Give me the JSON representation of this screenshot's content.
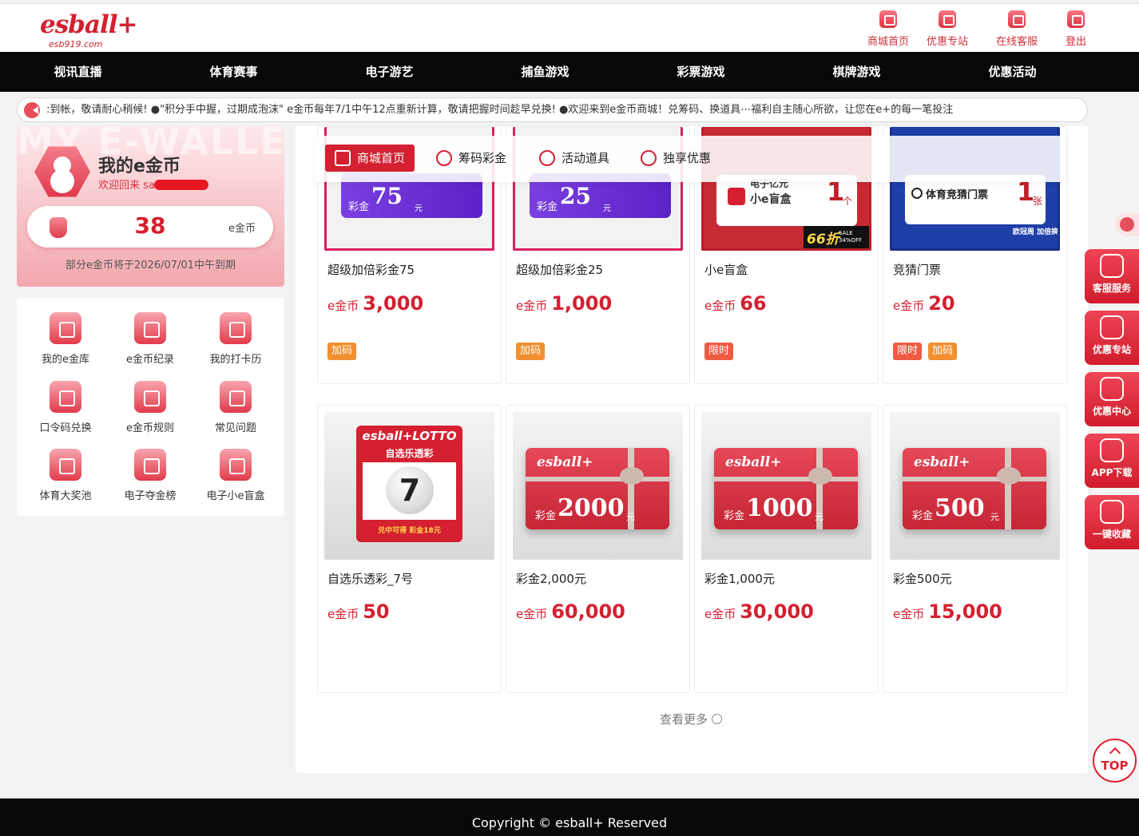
{
  "header": {
    "logo": "esball+",
    "domain": "esb919.com",
    "nav": [
      {
        "label": "商城首页",
        "icon": "home-icon"
      },
      {
        "label": "优惠专站",
        "icon": "flag-icon"
      },
      {
        "label": "在线客服",
        "icon": "chat-icon"
      },
      {
        "label": "登出",
        "icon": "logout-icon"
      }
    ]
  },
  "main_nav": [
    "视讯直播",
    "体育赛事",
    "电子游艺",
    "捕鱼游戏",
    "彩票游戏",
    "棋牌游戏",
    "优惠活动"
  ],
  "marquee": {
    "text": ":到帐，敬请耐心稍候!        ●\"积分手中握，过期成泡沫\" e金币每年7/1中午12点重新计算，敬请把握时间趁早兑换!        ●欢迎来到e金币商城！兑筹码、换道具⋯福利自主随心所欲，让您在e+的每一笔投注"
  },
  "wallet": {
    "bg_text": "MY E-WALLET",
    "title": "我的e金币",
    "welcome": "欢迎回来 sa",
    "balance": "38",
    "unit": "e金币",
    "expiry": "部分e金币将于2026/07/01中午到期"
  },
  "menu": [
    {
      "label": "我的e金库",
      "icon": "vault-icon"
    },
    {
      "label": "e金币纪录",
      "icon": "money-bag-icon"
    },
    {
      "label": "我的打卡历",
      "icon": "calendar-icon"
    },
    {
      "label": "口令码兑换",
      "icon": "lock-icon"
    },
    {
      "label": "e金币规则",
      "icon": "clipboard-icon"
    },
    {
      "label": "常见问题",
      "icon": "qa-icon"
    },
    {
      "label": "体育大奖池",
      "icon": "soccer-icon"
    },
    {
      "label": "电子夺金榜",
      "icon": "podium-icon"
    },
    {
      "label": "电子小e盲盒",
      "icon": "blind-box-icon"
    }
  ],
  "tabs": [
    {
      "label": "商城首页",
      "icon": "home-icon"
    },
    {
      "label": "筹码彩金",
      "icon": "chip-icon"
    },
    {
      "label": "活动道具",
      "icon": "diamond-icon"
    },
    {
      "label": "独享优惠",
      "icon": "gift-icon"
    }
  ],
  "products_row1": [
    {
      "name": "超级加倍彩金75",
      "unit": "e金币",
      "price": "3,000",
      "tags": [
        "加码"
      ],
      "voucher_label": "彩金",
      "voucher_value": "75",
      "voucher_unit": "元"
    },
    {
      "name": "超级加倍彩金25",
      "unit": "e金币",
      "price": "1,000",
      "tags": [
        "加码"
      ],
      "voucher_label": "彩金",
      "voucher_value": "25",
      "voucher_unit": "元"
    },
    {
      "name": "小e盲盒",
      "unit": "e金币",
      "price": "66",
      "tags": [
        "限时"
      ],
      "img_line1": "电子亿元",
      "img_line2": "小e盲盒",
      "img_count": "1",
      "img_count_unit": "个",
      "sale": "66折",
      "sale_sub": "SALE 34%OFF"
    },
    {
      "name": "竞猜门票",
      "unit": "e金币",
      "price": "20",
      "tags": [
        "限时",
        "加码"
      ],
      "img_line1": "体育竞猜门票",
      "img_count": "1",
      "img_count_unit": "张",
      "badge": "欧冠周 加倍换"
    }
  ],
  "products_row2": [
    {
      "name": "自选乐透彩_7号",
      "unit": "e金币",
      "price": "50",
      "lotto_brand": "esball+LOTTO",
      "lotto_title": "自选乐透彩",
      "lotto_ball": "7",
      "lotto_note": "兑中可得 彩金18元"
    },
    {
      "name": "彩金2,000元",
      "unit": "e金币",
      "price": "60,000",
      "gift_brand": "esball+",
      "gift_label": "彩金",
      "gift_value": "2000",
      "gift_unit": "元"
    },
    {
      "name": "彩金1,000元",
      "unit": "e金币",
      "price": "30,000",
      "gift_brand": "esball+",
      "gift_label": "彩金",
      "gift_value": "1000",
      "gift_unit": "元"
    },
    {
      "name": "彩金500元",
      "unit": "e金币",
      "price": "15,000",
      "gift_brand": "esball+",
      "gift_label": "彩金",
      "gift_value": "500",
      "gift_unit": "元"
    }
  ],
  "more": "查看更多",
  "side_buttons": [
    {
      "label": "客服服务",
      "icon": "headset-icon"
    },
    {
      "label": "优惠专站",
      "icon": "promo-icon"
    },
    {
      "label": "优惠中心",
      "icon": "gift-box-icon"
    },
    {
      "label": "APP下载",
      "icon": "phone-icon"
    },
    {
      "label": "一键收藏",
      "icon": "star-icon"
    }
  ],
  "top_button": "TOP",
  "footer": "Copyright © esball+ Reserved",
  "colors": {
    "brand": "#d42030",
    "nav_bg": "#080808",
    "tag_orange": "#f28f30",
    "tag_red": "#ee5b43"
  }
}
